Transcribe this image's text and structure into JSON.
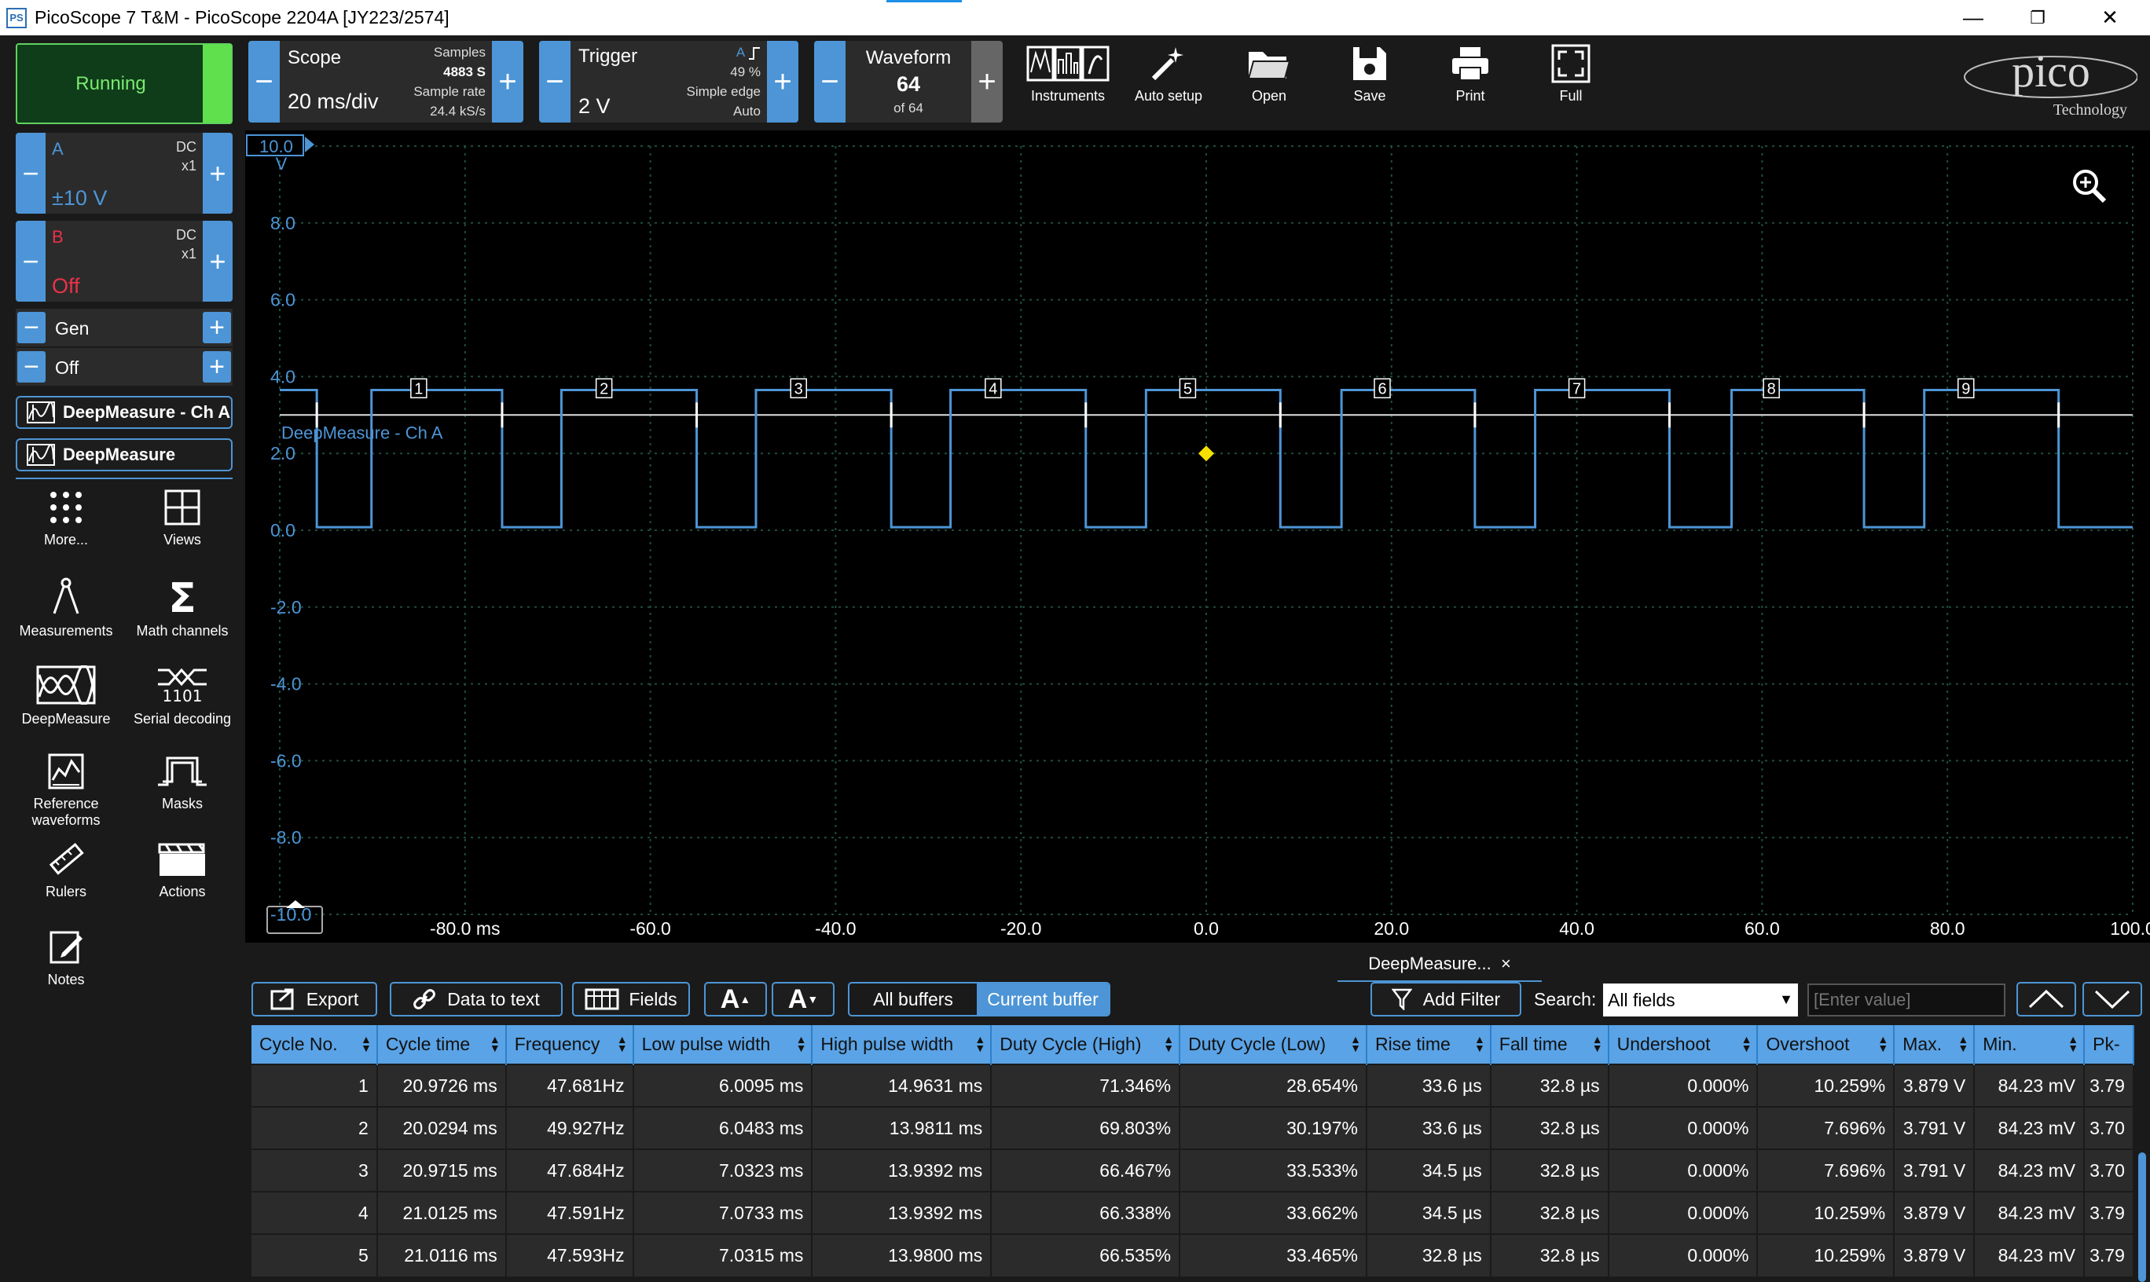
{
  "titlebar": {
    "app_icon": "PS",
    "title": "PicoScope 7 T&M  - PicoScope 2204A [JY223/2574]",
    "minimize": "—",
    "maximize": "❐",
    "close": "✕"
  },
  "status": {
    "label": "Running",
    "color": "#60e04c"
  },
  "channels": [
    {
      "name": "A",
      "coupling": "DC",
      "probe": "x1",
      "range": "±10 V",
      "color": "#4d95d6"
    },
    {
      "name": "B",
      "coupling": "DC",
      "probe": "x1",
      "range": "Off",
      "color": "#e8334a"
    }
  ],
  "generator": {
    "label": "Gen",
    "state": "Off"
  },
  "deepmeasure_buttons": [
    "DeepMeasure - Ch A",
    "DeepMeasure"
  ],
  "tools": [
    {
      "label": "More...",
      "icon": "dots-grid-icon"
    },
    {
      "label": "Views",
      "icon": "views-grid-icon"
    },
    {
      "label": "Measurements",
      "icon": "compass-icon"
    },
    {
      "label": "Math channels",
      "icon": "sigma-icon"
    },
    {
      "label": "DeepMeasure",
      "icon": "deepmeasure-icon"
    },
    {
      "label": "Serial decoding",
      "icon": "serial-decoding-icon"
    },
    {
      "label": "Reference waveforms",
      "icon": "reference-waveform-icon"
    },
    {
      "label": "Masks",
      "icon": "mask-icon"
    },
    {
      "label": "Rulers",
      "icon": "ruler-icon"
    },
    {
      "label": "Actions",
      "icon": "clapper-icon"
    },
    {
      "label": "Notes",
      "icon": "notes-icon"
    }
  ],
  "scope": {
    "label": "Scope",
    "timebase": "20 ms/div",
    "samples_label": "Samples",
    "samples": "4883 S",
    "rate_label": "Sample rate",
    "rate": "24.4 kS/s"
  },
  "trigger": {
    "label": "Trigger",
    "level": "2 V",
    "channel": "A",
    "edge_icon": "rising-edge-icon",
    "position": "49 %",
    "type": "Simple edge",
    "mode": "Auto"
  },
  "waveform": {
    "label": "Waveform",
    "current": "64",
    "of": "of 64"
  },
  "top_buttons": [
    {
      "label": "Instruments",
      "icon": "instruments-icon"
    },
    {
      "label": "Auto setup",
      "icon": "magic-wand-icon"
    },
    {
      "label": "Open",
      "icon": "folder-icon"
    },
    {
      "label": "Save",
      "icon": "save-icon"
    },
    {
      "label": "Print",
      "icon": "printer-icon"
    },
    {
      "label": "Full",
      "icon": "fullscreen-icon"
    }
  ],
  "logo": {
    "brand": "pico",
    "sub": "Technology"
  },
  "chart_data": {
    "type": "line",
    "series": [
      {
        "name": "DeepMeasure - Ch A",
        "color": "#4d95d6"
      }
    ],
    "y_range": [
      -10,
      10
    ],
    "y_top_label": "10.0",
    "y_unit": "V",
    "y_ticks": [
      "8.0",
      "6.0",
      "4.0",
      "2.0",
      "0.0",
      "-2.0",
      "-4.0",
      "-6.0",
      "-8.0",
      "-10.0"
    ],
    "x_range": [
      -100,
      100
    ],
    "x_ticks": [
      "-80.0 ms",
      "-60.0",
      "-40.0",
      "-20.0",
      "0.0",
      "20.0",
      "40.0",
      "60.0",
      "80.0",
      "100.0"
    ],
    "threshold_v": 3.0,
    "high_v": 3.65,
    "low_v": 0.08,
    "rising_edges_ms": [
      -90.1,
      -69.6,
      -48.6,
      -27.6,
      -6.5,
      14.6,
      35.5,
      56.7,
      77.5
    ],
    "falling_edges_ms": [
      -96.0,
      -76.0,
      -55.0,
      -34.0,
      -13.0,
      8.0,
      29.0,
      50.0,
      71.0,
      92.0
    ],
    "cycle_markers": [
      "1",
      "2",
      "3",
      "4",
      "5",
      "6",
      "7",
      "8",
      "9"
    ],
    "cycle_marker_ms": [
      -85.0,
      -65.0,
      -44.0,
      -23.0,
      -2.0,
      19.0,
      40.0,
      61.0,
      82.0
    ],
    "trigger_point": {
      "x_ms": 0.0,
      "y_v": 2.0
    },
    "grid": true,
    "zoom_icon": "zoom-in-icon"
  },
  "bottom_tab": {
    "label": "DeepMeasure...",
    "close": "×"
  },
  "bottom_toolbar": {
    "export": "Export",
    "data_to_text": "Data to text",
    "fields": "Fields",
    "font_up": "A",
    "font_down": "A",
    "all_buffers": "All buffers",
    "current_buffer": "Current buffer",
    "add_filter": "Add Filter",
    "search_label": "Search:",
    "search_field": "All fields",
    "value_placeholder": "[Enter value]"
  },
  "table": {
    "columns": [
      "Cycle No.",
      "Cycle time",
      "Frequency",
      "Low pulse width",
      "High pulse width",
      "Duty Cycle (High)",
      "Duty Cycle (Low)",
      "Rise time",
      "Fall time",
      "Undershoot",
      "Overshoot",
      "Max.",
      "Min.",
      "Pk-"
    ],
    "rows": [
      [
        "1",
        "20.9726 ms",
        "47.681Hz",
        "6.0095 ms",
        "14.9631 ms",
        "71.346%",
        "28.654%",
        "33.6 µs",
        "32.8 µs",
        "0.000%",
        "10.259%",
        "3.879 V",
        "84.23 mV",
        "3.79"
      ],
      [
        "2",
        "20.0294 ms",
        "49.927Hz",
        "6.0483 ms",
        "13.9811 ms",
        "69.803%",
        "30.197%",
        "33.6 µs",
        "32.8 µs",
        "0.000%",
        "7.696%",
        "3.791 V",
        "84.23 mV",
        "3.70"
      ],
      [
        "3",
        "20.9715 ms",
        "47.684Hz",
        "7.0323 ms",
        "13.9392 ms",
        "66.467%",
        "33.533%",
        "34.5 µs",
        "32.8 µs",
        "0.000%",
        "7.696%",
        "3.791 V",
        "84.23 mV",
        "3.70"
      ],
      [
        "4",
        "21.0125 ms",
        "47.591Hz",
        "7.0733 ms",
        "13.9392 ms",
        "66.338%",
        "33.662%",
        "34.5 µs",
        "32.8 µs",
        "0.000%",
        "10.259%",
        "3.879 V",
        "84.23 mV",
        "3.79"
      ],
      [
        "5",
        "21.0116 ms",
        "47.593Hz",
        "7.0315 ms",
        "13.9800 ms",
        "66.535%",
        "33.465%",
        "32.8 µs",
        "32.8 µs",
        "0.000%",
        "10.259%",
        "3.879 V",
        "84.23 mV",
        "3.79"
      ]
    ]
  }
}
